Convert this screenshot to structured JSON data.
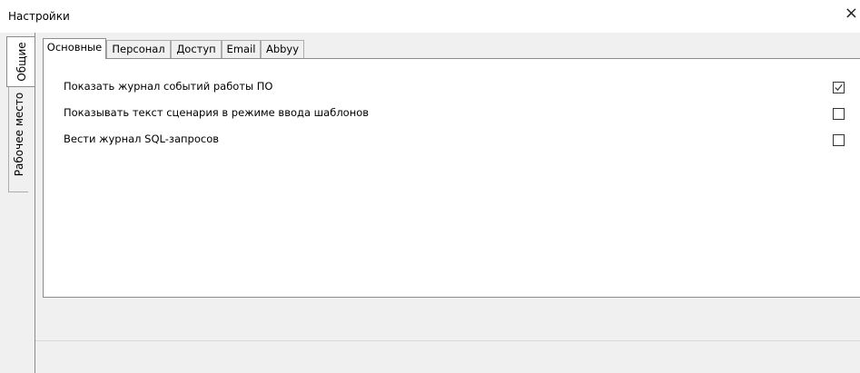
{
  "window": {
    "title": "Настройки",
    "close_glyph": "×"
  },
  "side_tabs": [
    {
      "label": "Общие",
      "active": true
    },
    {
      "label": "Рабочее место",
      "active": false
    }
  ],
  "tabs": [
    {
      "label": "Основные",
      "active": true
    },
    {
      "label": "Персонал",
      "active": false
    },
    {
      "label": "Доступ",
      "active": false
    },
    {
      "label": "Email",
      "active": false
    },
    {
      "label": "Abbyy",
      "active": false
    }
  ],
  "options": [
    {
      "label": "Показать журнал событий работы ПО",
      "checked": true
    },
    {
      "label": "Показывать текст сценария в режиме ввода шаблонов",
      "checked": false
    },
    {
      "label": "Вести журнал SQL-запросов",
      "checked": false
    }
  ]
}
